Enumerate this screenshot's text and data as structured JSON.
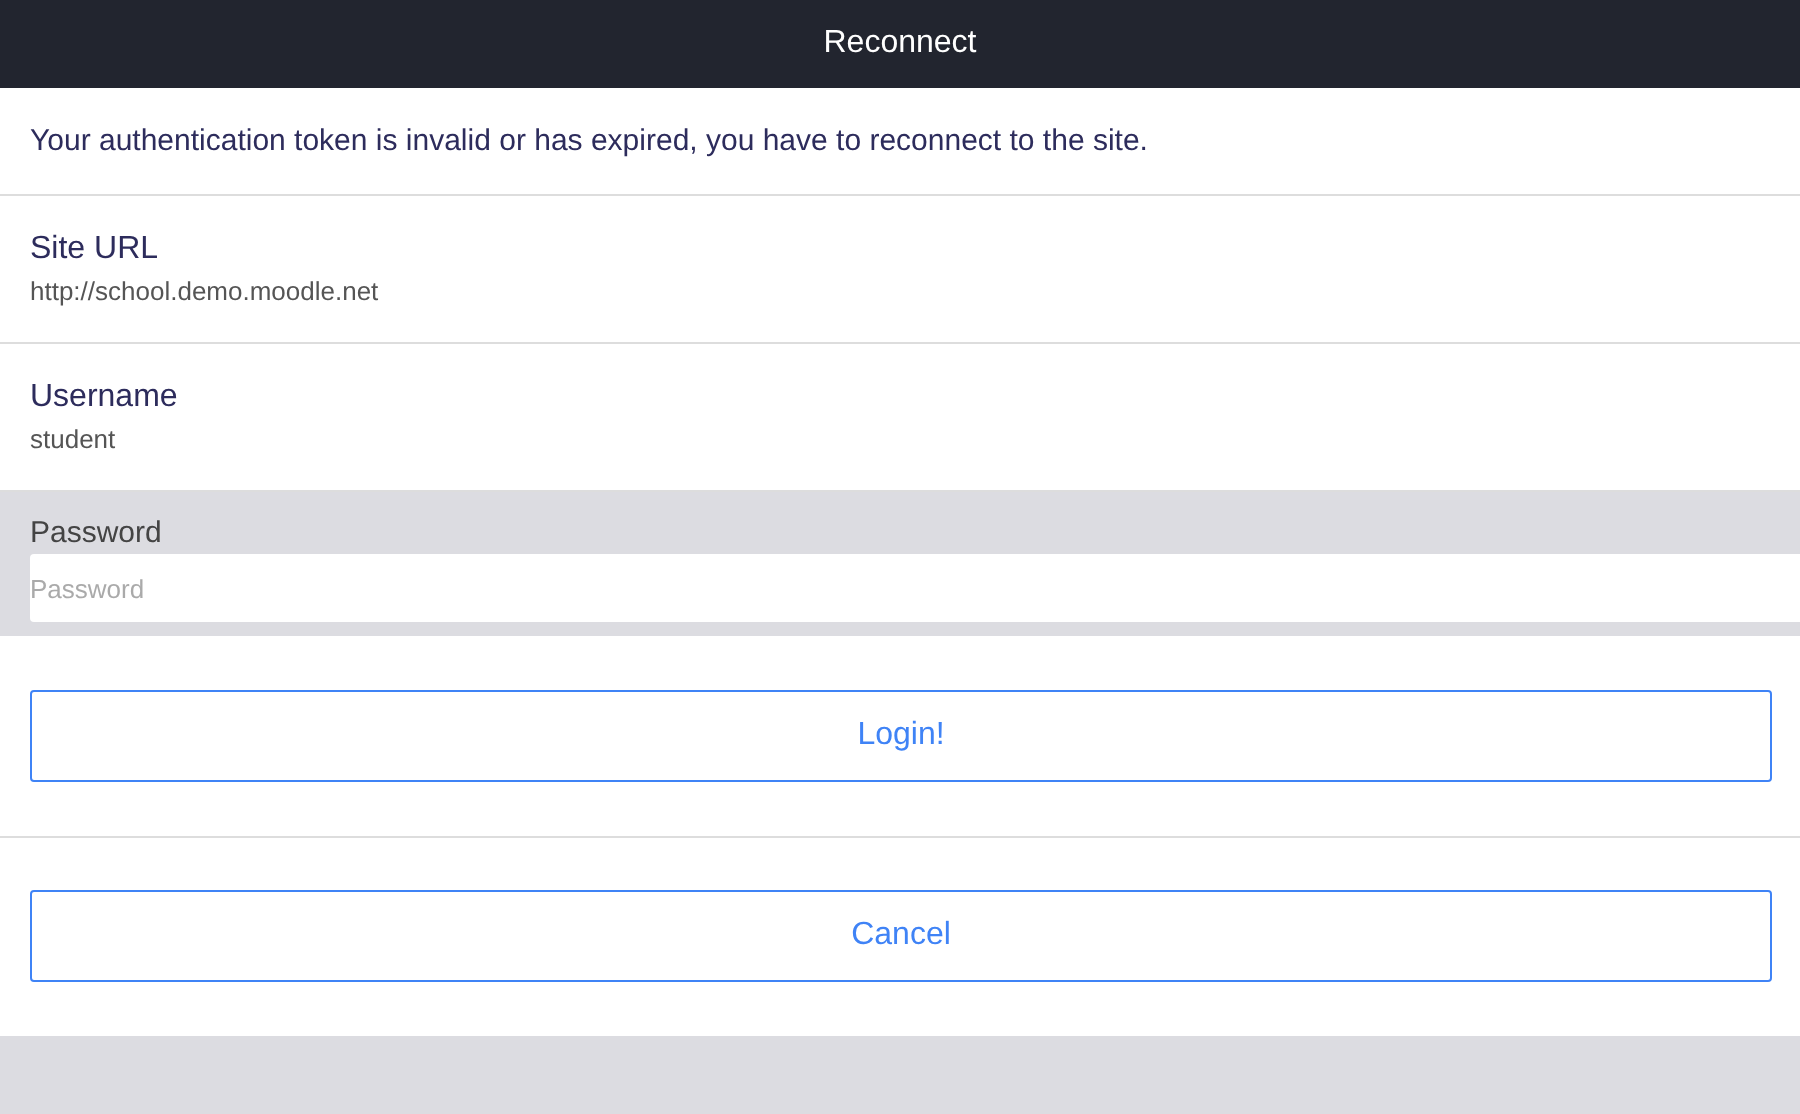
{
  "header": {
    "title": "Reconnect"
  },
  "message": "Your authentication token is invalid or has expired, you have to reconnect to the site.",
  "fields": [
    {
      "label": "Site URL",
      "value": "http://school.demo.moodle.net"
    },
    {
      "label": "Username",
      "value": "student"
    }
  ],
  "password": {
    "label": "Password",
    "placeholder": "Password"
  },
  "buttons": [
    "Login!",
    "Cancel"
  ]
}
